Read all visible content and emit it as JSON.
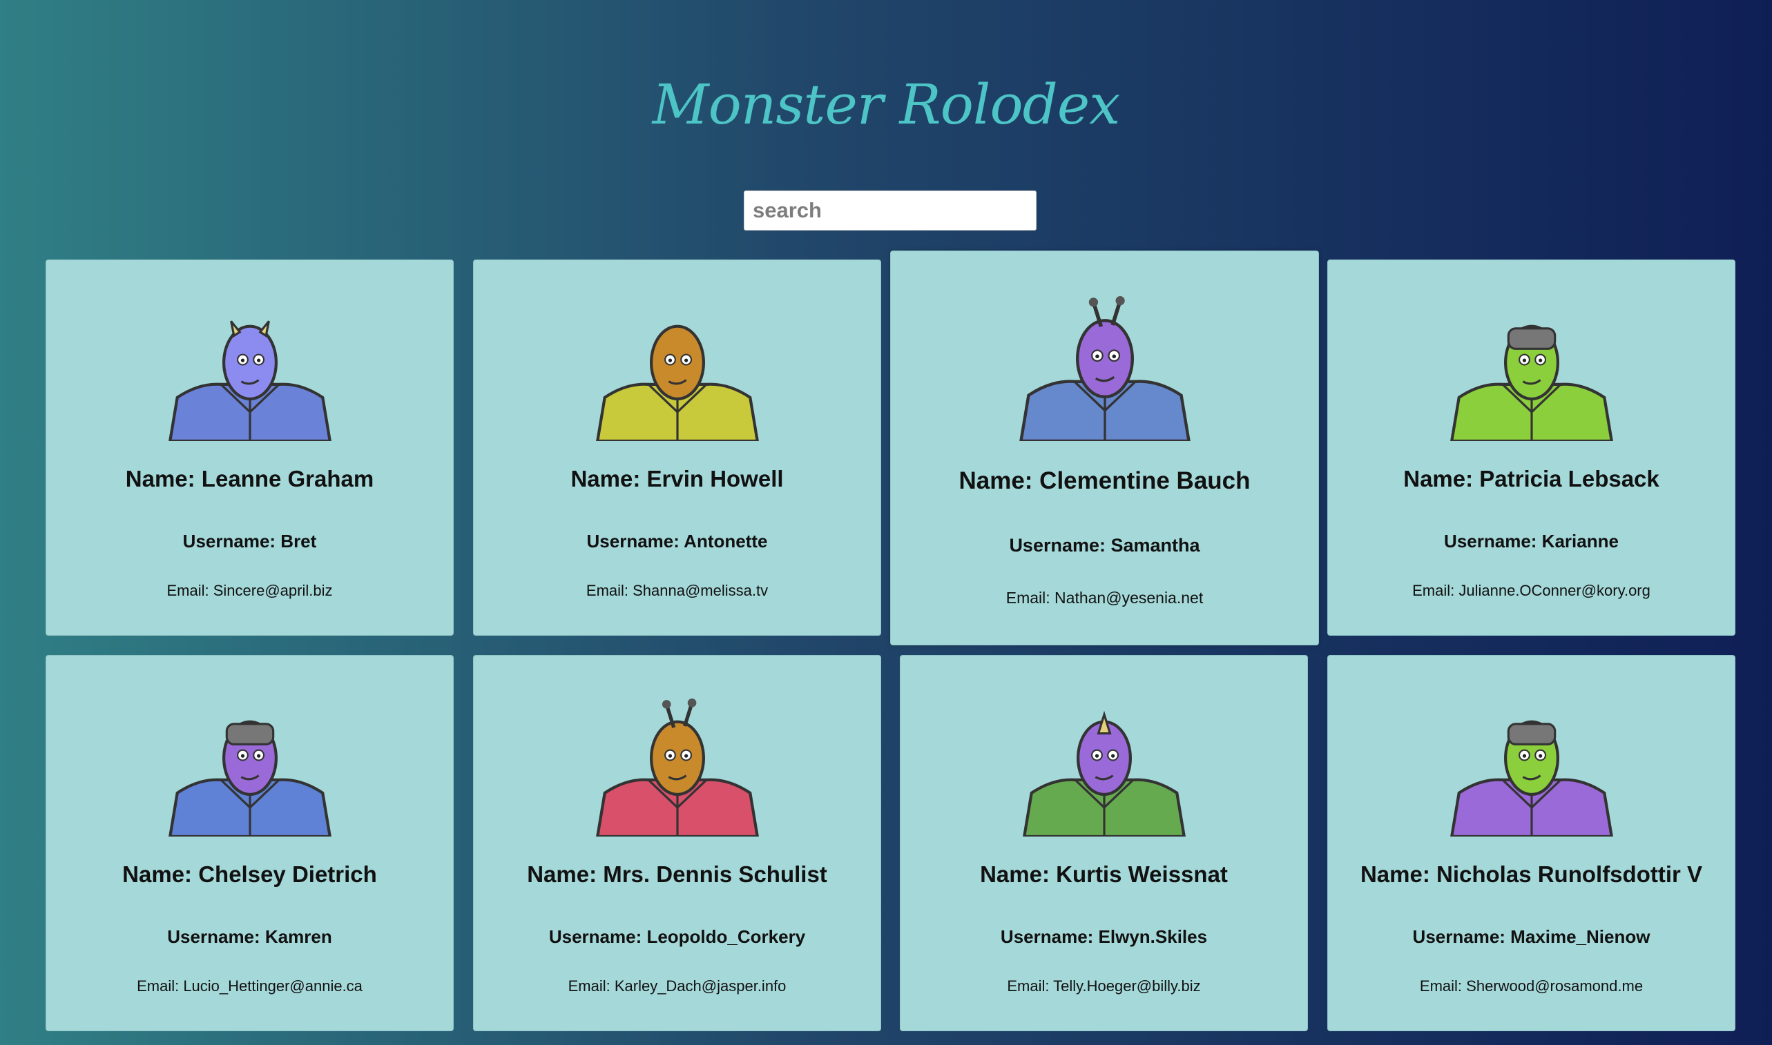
{
  "title": "Monster Rolodex",
  "search": {
    "placeholder": "search",
    "value": ""
  },
  "monsters": [
    {
      "name": "Name: Leanne Graham",
      "username": "Username: Bret",
      "email": "Email: Sincere@april.biz",
      "skin": "#8c8cf0",
      "body": "#6a82d8"
    },
    {
      "name": "Name: Ervin Howell",
      "username": "Username: Antonette",
      "email": "Email: Shanna@melissa.tv",
      "skin": "#c98a2c",
      "body": "#c9c93c"
    },
    {
      "name": "Name: Clementine Bauch",
      "username": "Username: Samantha",
      "email": "Email: Nathan@yesenia.net",
      "skin": "#9a6ad8",
      "body": "#6688cc"
    },
    {
      "name": "Name: Patricia Lebsack",
      "username": "Username: Karianne",
      "email": "Email: Julianne.OConner@kory.org",
      "skin": "#8ccf3c",
      "body": "#8ccf3c"
    },
    {
      "name": "Name: Chelsey Dietrich",
      "username": "Username: Kamren",
      "email": "Email: Lucio_Hettinger@annie.ca",
      "skin": "#9a6ad8",
      "body": "#5f82d6"
    },
    {
      "name": "Name: Mrs. Dennis Schulist",
      "username": "Username: Leopoldo_Corkery",
      "email": "Email: Karley_Dach@jasper.info",
      "skin": "#c98a2c",
      "body": "#d8506a"
    },
    {
      "name": "Name: Kurtis Weissnat",
      "username": "Username: Elwyn.Skiles",
      "email": "Email: Telly.Hoeger@billy.biz",
      "skin": "#9a6ad8",
      "body": "#66aa50"
    },
    {
      "name": "Name: Nicholas Runolfsdottir V",
      "username": "Username: Maxime_Nienow",
      "email": "Email: Sherwood@rosamond.me",
      "skin": "#8ccf3c",
      "body": "#9a6ad8"
    }
  ]
}
